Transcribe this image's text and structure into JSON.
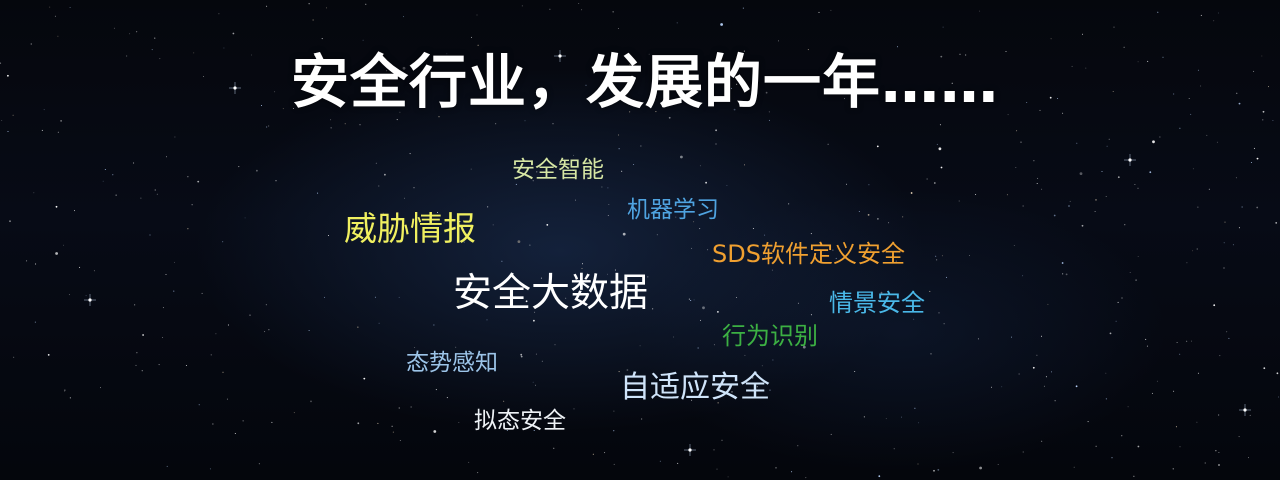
{
  "slide": {
    "title": "安全行业，发展的一年……",
    "title_color": "#ffffff",
    "background_color": "#05070d"
  },
  "keywords": [
    {
      "text": "安全智能",
      "color": "#d6e6a4"
    },
    {
      "text": "机器学习",
      "color": "#4fa3e0"
    },
    {
      "text": "威胁情报",
      "color": "#f0f060"
    },
    {
      "text": "SDS软件定义安全",
      "color": "#f0a030"
    },
    {
      "text": "安全大数据",
      "color": "#ffffff"
    },
    {
      "text": "情景安全",
      "color": "#4ab8e8"
    },
    {
      "text": "行为识别",
      "color": "#3cb043"
    },
    {
      "text": "态势感知",
      "color": "#9cc4e8"
    },
    {
      "text": "自适应安全",
      "color": "#cfe4fa"
    },
    {
      "text": "拟态安全",
      "color": "#eef2f6"
    }
  ]
}
